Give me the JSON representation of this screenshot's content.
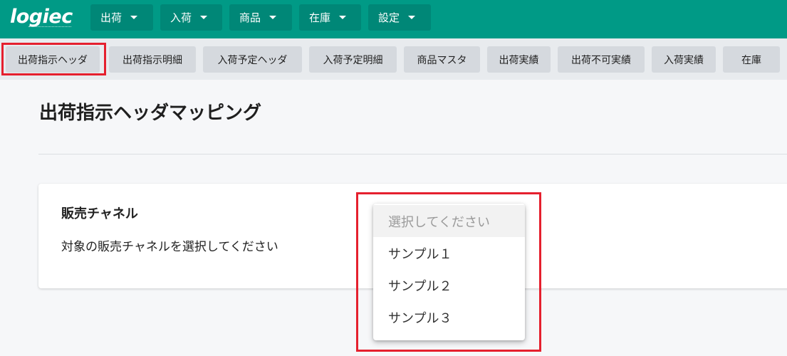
{
  "header": {
    "logo_text": "logiec",
    "menus": [
      {
        "label": "出荷"
      },
      {
        "label": "入荷"
      },
      {
        "label": "商品"
      },
      {
        "label": "在庫"
      },
      {
        "label": "設定"
      }
    ]
  },
  "tabs": [
    {
      "label": "出荷指示ヘッダ",
      "selected": true
    },
    {
      "label": "出荷指示明細"
    },
    {
      "label": "入荷予定ヘッダ"
    },
    {
      "label": "入荷予定明細"
    },
    {
      "label": "商品マスタ"
    },
    {
      "label": "出荷実績"
    },
    {
      "label": "出荷不可実績"
    },
    {
      "label": "入荷実績"
    },
    {
      "label": "在庫"
    }
  ],
  "page": {
    "title": "出荷指示ヘッダマッピング"
  },
  "sales_channel": {
    "title": "販売チャネル",
    "description": "対象の販売チャネルを選択してください",
    "placeholder": "選択してください",
    "options": [
      "サンプル１",
      "サンプル２",
      "サンプル３"
    ]
  },
  "colors": {
    "brand": "#009a86",
    "highlight": "#e5202e"
  }
}
